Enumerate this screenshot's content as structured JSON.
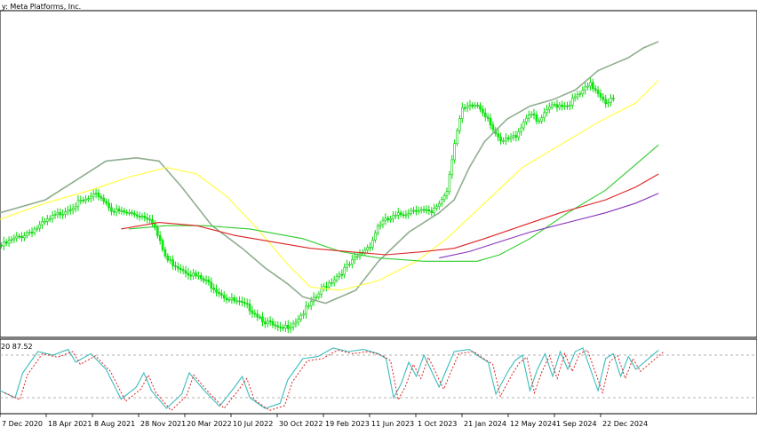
{
  "window": {
    "title": "y: Meta Platforms, Inc."
  },
  "oscillator": {
    "label": "20 87.52"
  },
  "chart_data": [
    {
      "type": "candlestick",
      "title": "Meta Platforms, Inc.",
      "up_color": "#00ff00",
      "down_color": "#00ff00",
      "ylim": [
        0,
        1
      ],
      "ma_series": [
        {
          "color": "#8fad8f",
          "values": [
            [
              0,
              0.38
            ],
            [
              0.06,
              0.42
            ],
            [
              0.1,
              0.48
            ],
            [
              0.14,
              0.54
            ],
            [
              0.18,
              0.55
            ],
            [
              0.21,
              0.54
            ],
            [
              0.24,
              0.46
            ],
            [
              0.28,
              0.34
            ],
            [
              0.32,
              0.27
            ],
            [
              0.35,
              0.21
            ],
            [
              0.38,
              0.16
            ],
            [
              0.4,
              0.12
            ],
            [
              0.43,
              0.1
            ],
            [
              0.47,
              0.14
            ],
            [
              0.5,
              0.23
            ],
            [
              0.54,
              0.32
            ],
            [
              0.58,
              0.38
            ],
            [
              0.6,
              0.42
            ],
            [
              0.62,
              0.52
            ],
            [
              0.64,
              0.6
            ],
            [
              0.67,
              0.67
            ],
            [
              0.7,
              0.71
            ],
            [
              0.73,
              0.73
            ],
            [
              0.76,
              0.76
            ],
            [
              0.79,
              0.82
            ],
            [
              0.81,
              0.84
            ],
            [
              0.83,
              0.86
            ],
            [
              0.85,
              0.89
            ],
            [
              0.87,
              0.91
            ]
          ]
        },
        {
          "color": "#ffff33",
          "values": [
            [
              0,
              0.36
            ],
            [
              0.06,
              0.41
            ],
            [
              0.12,
              0.45
            ],
            [
              0.17,
              0.49
            ],
            [
              0.22,
              0.52
            ],
            [
              0.26,
              0.5
            ],
            [
              0.3,
              0.43
            ],
            [
              0.34,
              0.33
            ],
            [
              0.38,
              0.22
            ],
            [
              0.41,
              0.15
            ],
            [
              0.45,
              0.14
            ],
            [
              0.5,
              0.17
            ],
            [
              0.55,
              0.23
            ],
            [
              0.59,
              0.3
            ],
            [
              0.64,
              0.41
            ],
            [
              0.69,
              0.52
            ],
            [
              0.74,
              0.59
            ],
            [
              0.79,
              0.66
            ],
            [
              0.84,
              0.72
            ],
            [
              0.87,
              0.79
            ]
          ]
        },
        {
          "color": "#2ecc2e",
          "values": [
            [
              0.17,
              0.33
            ],
            [
              0.22,
              0.34
            ],
            [
              0.27,
              0.34
            ],
            [
              0.33,
              0.33
            ],
            [
              0.4,
              0.3
            ],
            [
              0.45,
              0.26
            ],
            [
              0.5,
              0.24
            ],
            [
              0.56,
              0.23
            ],
            [
              0.6,
              0.23
            ],
            [
              0.63,
              0.23
            ],
            [
              0.66,
              0.25
            ],
            [
              0.7,
              0.3
            ],
            [
              0.75,
              0.38
            ],
            [
              0.8,
              0.45
            ],
            [
              0.84,
              0.53
            ],
            [
              0.87,
              0.59
            ]
          ]
        },
        {
          "color": "#dd2222",
          "values": [
            [
              0.16,
              0.33
            ],
            [
              0.21,
              0.35
            ],
            [
              0.26,
              0.34
            ],
            [
              0.31,
              0.31
            ],
            [
              0.36,
              0.29
            ],
            [
              0.41,
              0.27
            ],
            [
              0.46,
              0.26
            ],
            [
              0.51,
              0.25
            ],
            [
              0.56,
              0.26
            ],
            [
              0.6,
              0.27
            ],
            [
              0.64,
              0.3
            ],
            [
              0.69,
              0.34
            ],
            [
              0.74,
              0.38
            ],
            [
              0.8,
              0.42
            ],
            [
              0.84,
              0.46
            ],
            [
              0.87,
              0.5
            ]
          ]
        },
        {
          "color": "#8833bb",
          "values": [
            [
              0.58,
              0.24
            ],
            [
              0.62,
              0.26
            ],
            [
              0.66,
              0.29
            ],
            [
              0.7,
              0.32
            ],
            [
              0.75,
              0.35
            ],
            [
              0.8,
              0.38
            ],
            [
              0.84,
              0.41
            ],
            [
              0.87,
              0.44
            ]
          ]
        }
      ]
    },
    {
      "type": "line",
      "title": "",
      "ylim": [
        0,
        100
      ],
      "levels": [
        80,
        20
      ],
      "series": [
        {
          "color": "#3cbcbc",
          "style": "solid"
        },
        {
          "color": "#dd2222",
          "style": "dashed"
        }
      ]
    }
  ],
  "x_axis": {
    "ticks": [
      "7 Dec 2020",
      "18 Apr 2021",
      "8 Aug 2021",
      "28 Nov 2021",
      "20 Mar 2022",
      "10 Jul 2022",
      "30 Oct 2022",
      "19 Feb 2023",
      "11 Jun 2023",
      "1 Oct 2023",
      "21 Jan 2024",
      "12 May 2024",
      "1 Sep 2024",
      "22 Dec 2024"
    ]
  }
}
